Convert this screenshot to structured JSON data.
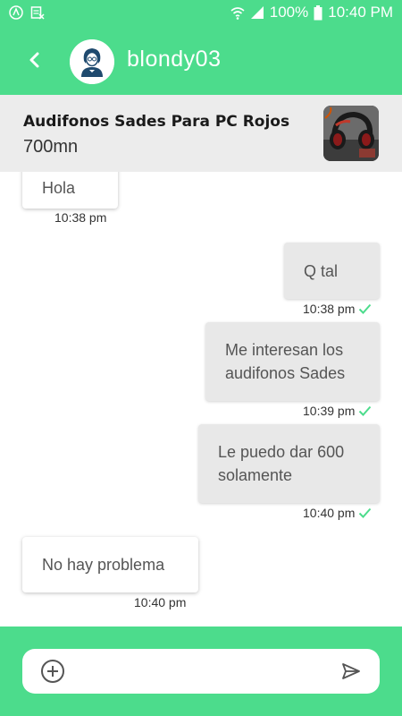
{
  "status_bar": {
    "battery": "100%",
    "time": "10:40 PM"
  },
  "header": {
    "contact_name": "blondy03"
  },
  "product": {
    "title": "Audifonos Sades Para PC Rojos",
    "price": "700mn"
  },
  "messages": [
    {
      "text": "Hola",
      "time": "10:38 pm",
      "direction": "incoming"
    },
    {
      "text": "Q tal",
      "time": "10:38 pm",
      "direction": "outgoing",
      "read": true
    },
    {
      "text": "Me interesan los audifonos Sades",
      "time": "10:39 pm",
      "direction": "outgoing",
      "read": true
    },
    {
      "text": "Le puedo dar 600 solamente",
      "time": "10:40 pm",
      "direction": "outgoing",
      "read": true
    },
    {
      "text": "No hay problema",
      "time": "10:40 pm",
      "direction": "incoming"
    }
  ],
  "composer": {
    "placeholder": ""
  },
  "colors": {
    "accent": "#4cdc8c",
    "check": "#4cdc8c",
    "bubble_out": "#e8e8e8"
  },
  "icons": {
    "back": "back-arrow-icon",
    "add": "plus-circle-icon",
    "send": "send-icon"
  }
}
